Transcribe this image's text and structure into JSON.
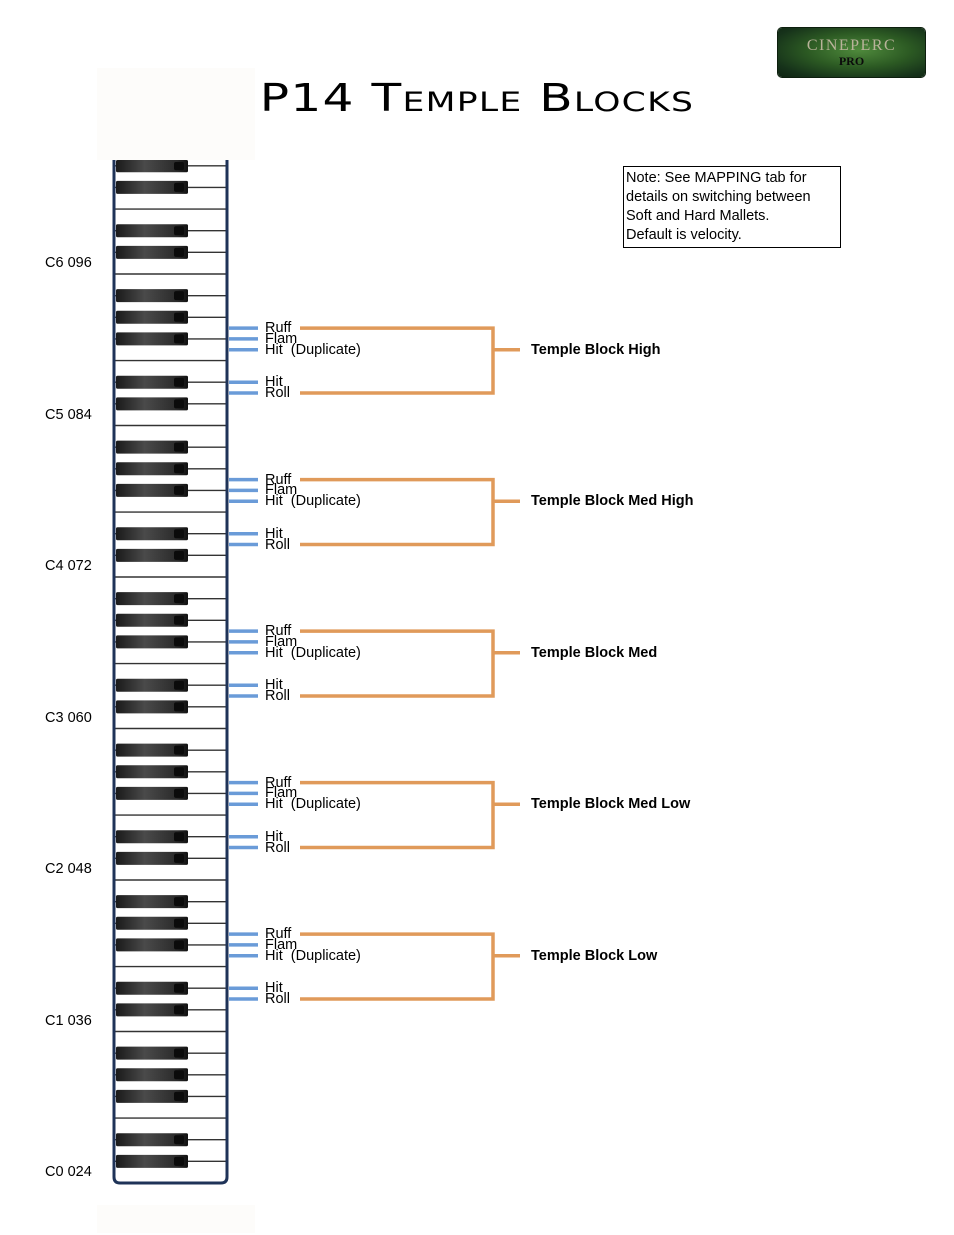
{
  "header": {
    "title": "P14 Temple Blocks",
    "logo": {
      "line1": "CINEPERC",
      "line2": "PRO"
    }
  },
  "note": {
    "lines": [
      "Note: See MAPPING tab for",
      "details on switching between",
      "Soft and Hard Mallets.",
      "Default is velocity."
    ]
  },
  "colors": {
    "articulation_line": "#6a9bd8",
    "bracket": "#e09a5a",
    "keyboard_border": "#1f3358",
    "text": "#000000"
  },
  "keyboard": {
    "lowest_octave": 0,
    "octave_labels": [
      {
        "note": "C6",
        "midi": "096",
        "label": "C6 096"
      },
      {
        "note": "C5",
        "midi": "084",
        "label": "C5 084"
      },
      {
        "note": "C4",
        "midi": "072",
        "label": "C4 072"
      },
      {
        "note": "C3",
        "midi": "060",
        "label": "C3 060"
      },
      {
        "note": "C2",
        "midi": "048",
        "label": "C2 048"
      },
      {
        "note": "C1",
        "midi": "036",
        "label": "C1 036"
      },
      {
        "note": "C0",
        "midi": "024",
        "label": "C0 024"
      }
    ]
  },
  "groups": [
    {
      "name": "Temple Block High",
      "articulations": [
        {
          "label": "Ruff",
          "note": "G5"
        },
        {
          "label": "Flam",
          "note": "F#5"
        },
        {
          "label": "Hit  (Duplicate)",
          "note": "F5"
        },
        {
          "label": "Hit",
          "note": "D#5"
        },
        {
          "label": "Roll",
          "note": "D5"
        }
      ]
    },
    {
      "name": "Temple Block Med High",
      "articulations": [
        {
          "label": "Ruff",
          "note": "G4"
        },
        {
          "label": "Flam",
          "note": "F#4"
        },
        {
          "label": "Hit  (Duplicate)",
          "note": "F4"
        },
        {
          "label": "Hit",
          "note": "D#4"
        },
        {
          "label": "Roll",
          "note": "D4"
        }
      ]
    },
    {
      "name": "Temple Block Med",
      "articulations": [
        {
          "label": "Ruff",
          "note": "G3"
        },
        {
          "label": "Flam",
          "note": "F#3"
        },
        {
          "label": "Hit  (Duplicate)",
          "note": "F3"
        },
        {
          "label": "Hit",
          "note": "D#3"
        },
        {
          "label": "Roll",
          "note": "D3"
        }
      ]
    },
    {
      "name": "Temple Block Med Low",
      "articulations": [
        {
          "label": "Ruff",
          "note": "G2"
        },
        {
          "label": "Flam",
          "note": "F#2"
        },
        {
          "label": "Hit  (Duplicate)",
          "note": "F2"
        },
        {
          "label": "Hit",
          "note": "D#2"
        },
        {
          "label": "Roll",
          "note": "D2"
        }
      ]
    },
    {
      "name": "Temple Block Low",
      "articulations": [
        {
          "label": "Ruff",
          "note": "G1"
        },
        {
          "label": "Flam",
          "note": "F#1"
        },
        {
          "label": "Hit  (Duplicate)",
          "note": "F1"
        },
        {
          "label": "Hit",
          "note": "D#1"
        },
        {
          "label": "Roll",
          "note": "D1"
        }
      ]
    }
  ]
}
